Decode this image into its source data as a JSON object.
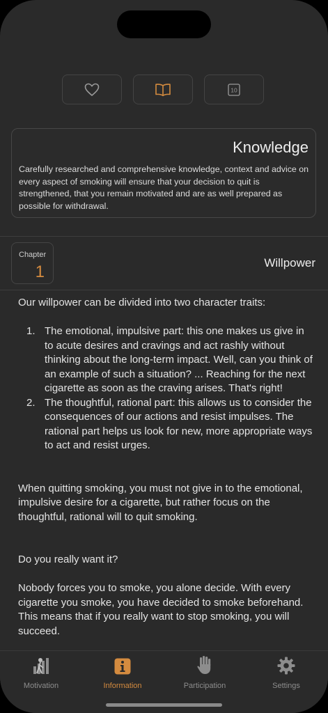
{
  "top_buttons": [
    {
      "icon": "heart-icon"
    },
    {
      "icon": "book-icon",
      "active": true
    },
    {
      "icon": "ten-box-icon",
      "text": "10"
    }
  ],
  "knowledge": {
    "title": "Knowledge",
    "description": "Carefully researched and comprehensive knowledge, context and advice on every aspect of smoking will ensure that your decision to quit is strengthened, that you remain motivated and are as well prepared as possible for withdrawal."
  },
  "chapter": {
    "label": "Chapter",
    "number": "1",
    "title": "Willpower"
  },
  "content": {
    "intro": "Our willpower can be divided into two character traits:",
    "list": [
      {
        "num": "1.",
        "text": "The emotional, impulsive part: this one makes us give in to acute desires and cravings and act rashly without thinking about the long-term impact. Well, can you think of an example of such a situation? ... Reaching for the next cigarette as soon as the craving arises. That's right!"
      },
      {
        "num": "2.",
        "text": "The thoughtful, rational part: this allows us to consider the consequences of our actions and resist impulses. The rational part helps us look for new, more appropriate ways to act and resist urges."
      }
    ],
    "para1": "When quitting smoking, you must not give in to the emotional, impulsive desire for a cigarette, but rather focus on the thoughtful, rational will to quit smoking.",
    "para2": "Do you really want it?",
    "para3": "Nobody forces you to smoke, you alone decide. With every cigarette you smoke, you have decided to smoke beforehand. This means that if you really want to stop smoking, you will succeed."
  },
  "tabs": [
    {
      "label": "Motivation",
      "icon": "motivation-chart-icon"
    },
    {
      "label": "Information",
      "icon": "info-icon",
      "active": true
    },
    {
      "label": "Participation",
      "icon": "hand-icon"
    },
    {
      "label": "Settings",
      "icon": "gear-icon"
    }
  ],
  "colors": {
    "accent": "#d48b3f",
    "background": "#2a2a2a",
    "inactive": "#8d8d8d"
  }
}
